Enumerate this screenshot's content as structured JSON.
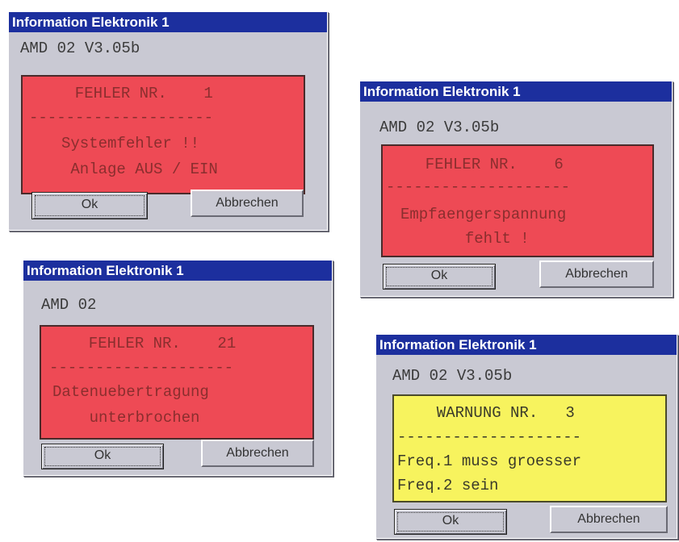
{
  "dialogs": [
    {
      "title": "Information Elektronik 1",
      "version": "AMD 02  V3.05b",
      "type": "error",
      "header": "  FEHLER NR.    1",
      "divider": "--------------------",
      "lines": [
        "Systemfehler !!",
        " Anlage AUS / EIN"
      ],
      "ok_label": "Ok",
      "cancel_label": "Abbrechen"
    },
    {
      "title": "Information Elektronik 1",
      "version": "AMD 02  V3.05b",
      "type": "error",
      "header": "  FEHLER NR.    6",
      "divider": "--------------------",
      "lines": [
        "Empfaengerspannung",
        "       fehlt !"
      ],
      "ok_label": "Ok",
      "cancel_label": "Abbrechen"
    },
    {
      "title": "Information Elektronik 1",
      "version": "AMD 02",
      "type": "error",
      "header": "  FEHLER NR.    21",
      "divider": "--------------------",
      "lines": [
        "Datenuebertragung",
        "    unterbrochen"
      ],
      "ok_label": "Ok",
      "cancel_label": "Abbrechen"
    },
    {
      "title": "Information Elektronik 1",
      "version": "AMD 02  V3.05b",
      "type": "warning",
      "header": "  WARNUNG NR.   3",
      "divider": "--------------------",
      "lines": [
        "Freq.1 muss groesser",
        "Freq.2 sein"
      ],
      "ok_label": "Ok",
      "cancel_label": "Abbrechen"
    }
  ],
  "colors": {
    "titlebar": "#1c2f9e",
    "error_panel": "#ee4a55",
    "warning_panel": "#f7f35e",
    "dialog_bg": "#c9c9d3"
  }
}
